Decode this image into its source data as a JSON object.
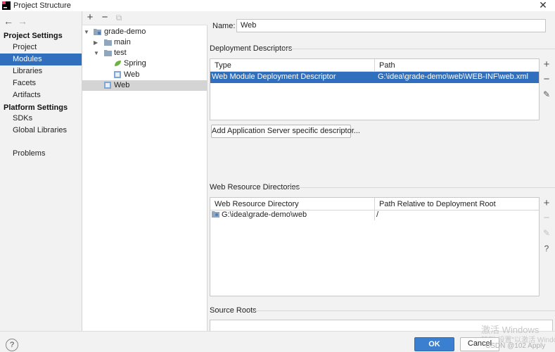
{
  "window": {
    "title": "Project Structure"
  },
  "nav": {
    "back_icon": "arrow-left-icon",
    "forward_icon": "arrow-right-icon",
    "project_settings_title": "Project Settings",
    "project_settings": [
      "Project",
      "Modules",
      "Libraries",
      "Facets",
      "Artifacts"
    ],
    "platform_settings_title": "Platform Settings",
    "platform_settings": [
      "SDKs",
      "Global Libraries"
    ],
    "problems": "Problems",
    "selected": "Modules"
  },
  "tree": {
    "toolbar": [
      "add-icon",
      "remove-icon",
      "copy-icon"
    ],
    "items": [
      {
        "label": "grade-demo",
        "icon": "module-folder-icon"
      },
      {
        "label": "main",
        "icon": "folder-icon"
      },
      {
        "label": "test",
        "icon": "folder-icon"
      },
      {
        "label": "Spring",
        "icon": "spring-leaf-icon"
      },
      {
        "label": "Web",
        "icon": "web-facet-icon"
      },
      {
        "label": "Web",
        "icon": "web-facet-icon"
      }
    ]
  },
  "facet": {
    "name_label": "Name:",
    "name_value": "Web",
    "deployment_descriptors": {
      "title": "Deployment Descriptors",
      "columns": [
        "Type",
        "Path"
      ],
      "rows": [
        {
          "type": "Web Module Deployment Descriptor",
          "path": "G:\\idea\\grade-demo\\web\\WEB-INF\\web.xml"
        }
      ],
      "add_server_button": "Add Application Server specific descriptor..."
    },
    "web_resources": {
      "title": "Web Resource Directories",
      "columns": [
        "Web Resource Directory",
        "Path Relative to Deployment Root"
      ],
      "rows": [
        {
          "dir": "G:\\idea\\grade-demo\\web",
          "relative": "/"
        }
      ]
    },
    "source_roots_title": "Source Roots"
  },
  "footer": {
    "help": "?",
    "ok": "OK",
    "cancel": "Cancel",
    "watermark_1": "激活 Windows",
    "watermark_2": "转到\"设置\"以激活 Windows。",
    "watermark_3": "CSDN @102 Apply"
  },
  "colors": {
    "selection": "#2f6fbd",
    "ok_button": "#3a7fd0"
  }
}
